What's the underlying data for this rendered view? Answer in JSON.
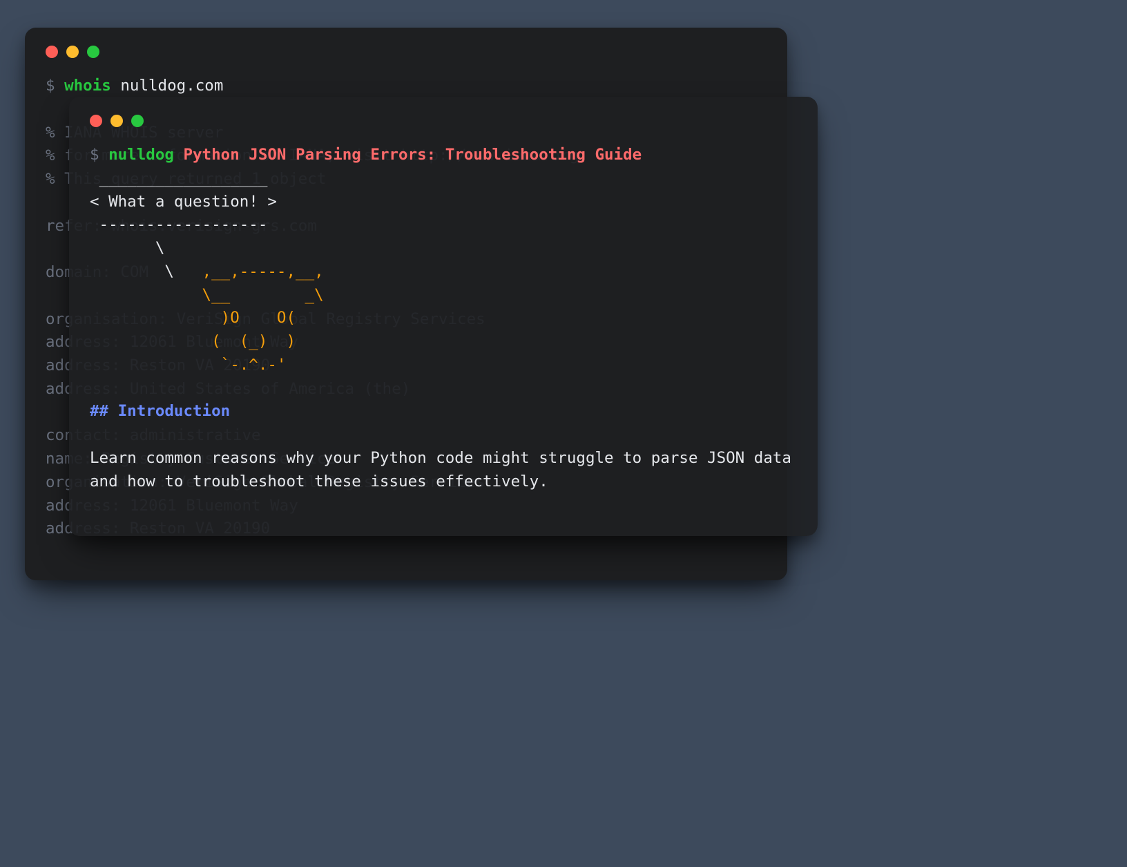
{
  "back": {
    "prompt": "$",
    "command": "whois",
    "arg": "nulldog.com",
    "lines": [
      "% IANA WHOIS server",
      "% for more information on IANA, visit http://www.iana.org",
      "% This query returned 1 object"
    ],
    "refer_label": "refer:",
    "refer_value": "whois.verisign-grs.com",
    "domain_label": "domain:",
    "domain_value": "COM",
    "org_label": "organisation:",
    "org_value": "VeriSign Global Registry Services",
    "addr_label": "address:",
    "addr1": "12061 Bluemont Way",
    "addr2": "Reston VA 20190",
    "addr3": "United States of America (the)",
    "contact_label": "contact:",
    "contact_value": "administrative",
    "name_label": "name:",
    "name_value": "Registry Customer Service",
    "org2_value": "VeriSign Global Registry Services",
    "addr4": "12061 Bluemont Way",
    "addr5": "Reston VA 20190"
  },
  "front": {
    "prompt": "$",
    "command": "nulldog",
    "title": "Python JSON Parsing Errors: Troubleshooting Guide",
    "bubble_top": " __________________",
    "bubble_text": "< What a question! >",
    "bubble_bottom": " ------------------",
    "cow1": "       \\",
    "cow2": "        \\   ,__,-----,__,",
    "cow3": "            \\__        _\\",
    "cow4": "              )O    O(",
    "cow5": "             (  (_)  )",
    "cow6": "              `-.^.-'",
    "heading": "## Introduction",
    "body": "Learn common reasons why your Python code might struggle to parse JSON data and how to troubleshoot these issues effectively."
  }
}
